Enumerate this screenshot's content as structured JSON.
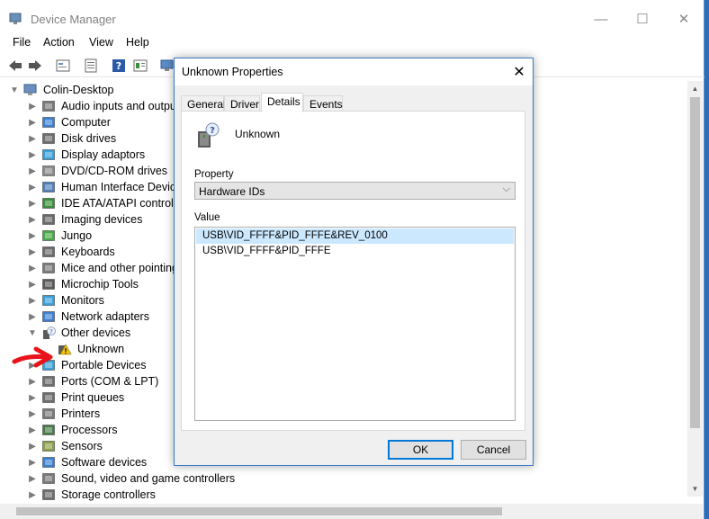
{
  "window": {
    "title": "Device Manager",
    "minimize_glyph": "—",
    "maximize_glyph": "☐",
    "close_glyph": "✕"
  },
  "menu": [
    "File",
    "Action",
    "View",
    "Help"
  ],
  "toolbar_icons": [
    "back-icon",
    "forward-icon",
    "properties-icon",
    "update-icon",
    "help-icon",
    "view-icon",
    "scan-hardware-icon"
  ],
  "tree": {
    "root": "Colin-Desktop",
    "items": [
      {
        "label": "Audio inputs and outputs",
        "icon": "speaker-icon",
        "expanded": false
      },
      {
        "label": "Computer",
        "icon": "computer-icon",
        "expanded": false
      },
      {
        "label": "Disk drives",
        "icon": "disk-icon",
        "expanded": false
      },
      {
        "label": "Display adaptors",
        "icon": "display-icon",
        "expanded": false
      },
      {
        "label": "DVD/CD-ROM drives",
        "icon": "dvd-icon",
        "expanded": false
      },
      {
        "label": "Human Interface Devices",
        "icon": "hid-icon",
        "expanded": false
      },
      {
        "label": "IDE ATA/ATAPI controllers",
        "icon": "ide-icon",
        "expanded": false
      },
      {
        "label": "Imaging devices",
        "icon": "camera-icon",
        "expanded": false
      },
      {
        "label": "Jungo",
        "icon": "jungo-icon",
        "expanded": false
      },
      {
        "label": "Keyboards",
        "icon": "keyboard-icon",
        "expanded": false
      },
      {
        "label": "Mice and other pointing devices",
        "icon": "mouse-icon",
        "expanded": false
      },
      {
        "label": "Microchip Tools",
        "icon": "chip-icon",
        "expanded": false
      },
      {
        "label": "Monitors",
        "icon": "monitor-icon",
        "expanded": false
      },
      {
        "label": "Network adapters",
        "icon": "network-icon",
        "expanded": false
      },
      {
        "label": "Other devices",
        "icon": "unknown-device-icon",
        "expanded": true
      },
      {
        "label": "Unknown",
        "icon": "warning-device-icon",
        "child": true
      },
      {
        "label": "Portable Devices",
        "icon": "portable-icon",
        "expanded": false
      },
      {
        "label": "Ports (COM & LPT)",
        "icon": "port-icon",
        "expanded": false
      },
      {
        "label": "Print queues",
        "icon": "print-queue-icon",
        "expanded": false
      },
      {
        "label": "Printers",
        "icon": "printer-icon",
        "expanded": false
      },
      {
        "label": "Processors",
        "icon": "processor-icon",
        "expanded": false
      },
      {
        "label": "Sensors",
        "icon": "sensor-icon",
        "expanded": false
      },
      {
        "label": "Software devices",
        "icon": "software-icon",
        "expanded": false
      },
      {
        "label": "Sound, video and game controllers",
        "icon": "sound-icon",
        "expanded": false
      },
      {
        "label": "Storage controllers",
        "icon": "storage-icon",
        "expanded": false
      }
    ]
  },
  "dialog": {
    "title": "Unknown Properties",
    "close_glyph": "✕",
    "tabs": [
      "General",
      "Driver",
      "Details",
      "Events"
    ],
    "active_tab": "Details",
    "device_name": "Unknown",
    "property_label": "Property",
    "property_value": "Hardware IDs",
    "value_label": "Value",
    "values": [
      "USB\\VID_FFFF&PID_FFFE&REV_0100",
      "USB\\VID_FFFF&PID_FFFE"
    ],
    "ok_label": "OK",
    "cancel_label": "Cancel"
  },
  "colors": {
    "accent": "#0078d7",
    "selection": "#cce8ff",
    "annotation_arrow": "#e8141a"
  }
}
